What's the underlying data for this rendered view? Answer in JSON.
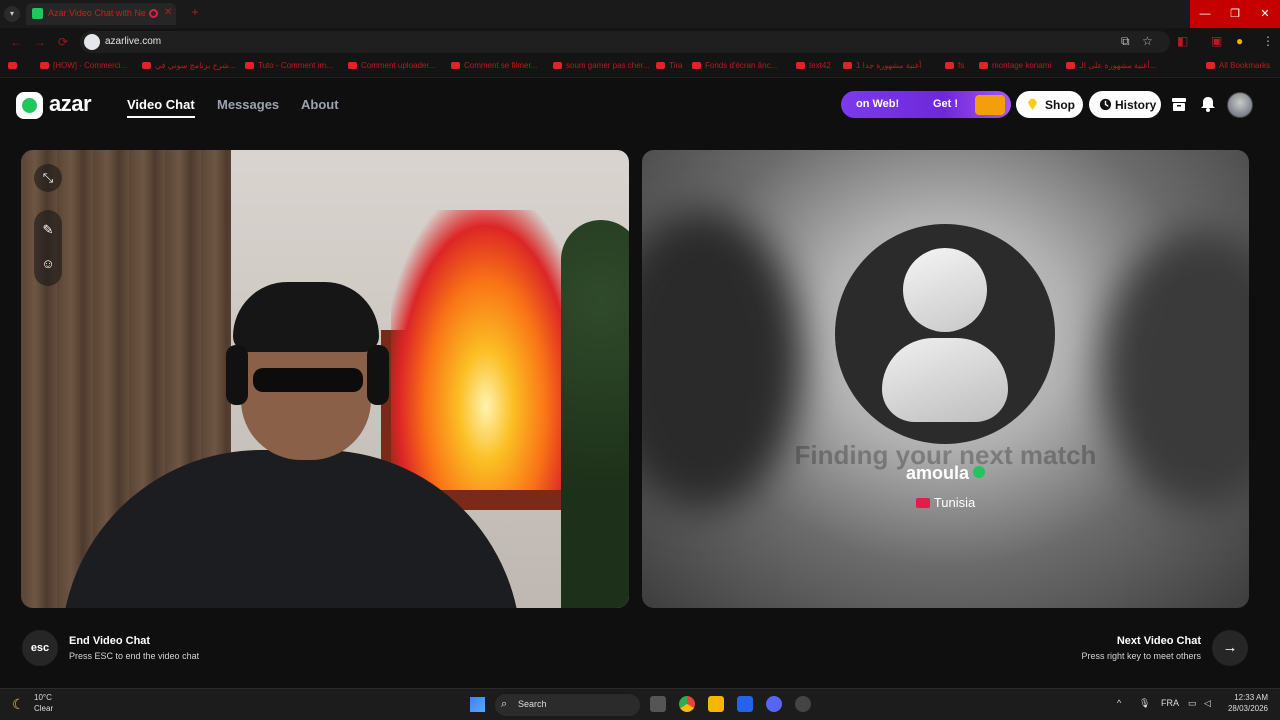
{
  "browser": {
    "tab_title": "Azar Video Chat with Ne",
    "url": "azarlive.com",
    "bookmarks": [
      "[HOW] - Commerci...",
      "شرح برنامج سوني في...",
      "Tuto - Comment im...",
      "Comment uploader...",
      "Comment se filmer...",
      "soum gamer pas cher...",
      "Tira",
      "Fonds d'écran ânc...",
      "text42",
      "1 أغنية مشهورة جدا",
      "fs",
      "montage konami",
      "أغنية مشهورة على الـ...",
      "All Bookmarks"
    ]
  },
  "site": {
    "logo": "azar",
    "nav": {
      "video_chat": "Video Chat",
      "messages": "Messages",
      "about": "About"
    },
    "promo": {
      "text1": "on Web!",
      "text2": "Get !"
    },
    "shop": "Shop",
    "history": "History"
  },
  "match": {
    "finding": "Finding your next match",
    "name": "amoula",
    "country": "Tunisia"
  },
  "controls": {
    "esc_key": "esc",
    "end_title": "End Video Chat",
    "end_sub": "Press ESC to end the video chat",
    "next_title": "Next Video Chat",
    "next_sub": "Press right key to meet others",
    "next_arrow": "→"
  },
  "taskbar": {
    "temp": "10°C",
    "weather": "Clear",
    "search": "Search",
    "lang": "FRA",
    "time": "12:33 AM",
    "date": "28/03/2026"
  },
  "colors": {
    "accent": "#22c55e",
    "promo": "#7c3aed",
    "browser_red": "#c40000"
  }
}
